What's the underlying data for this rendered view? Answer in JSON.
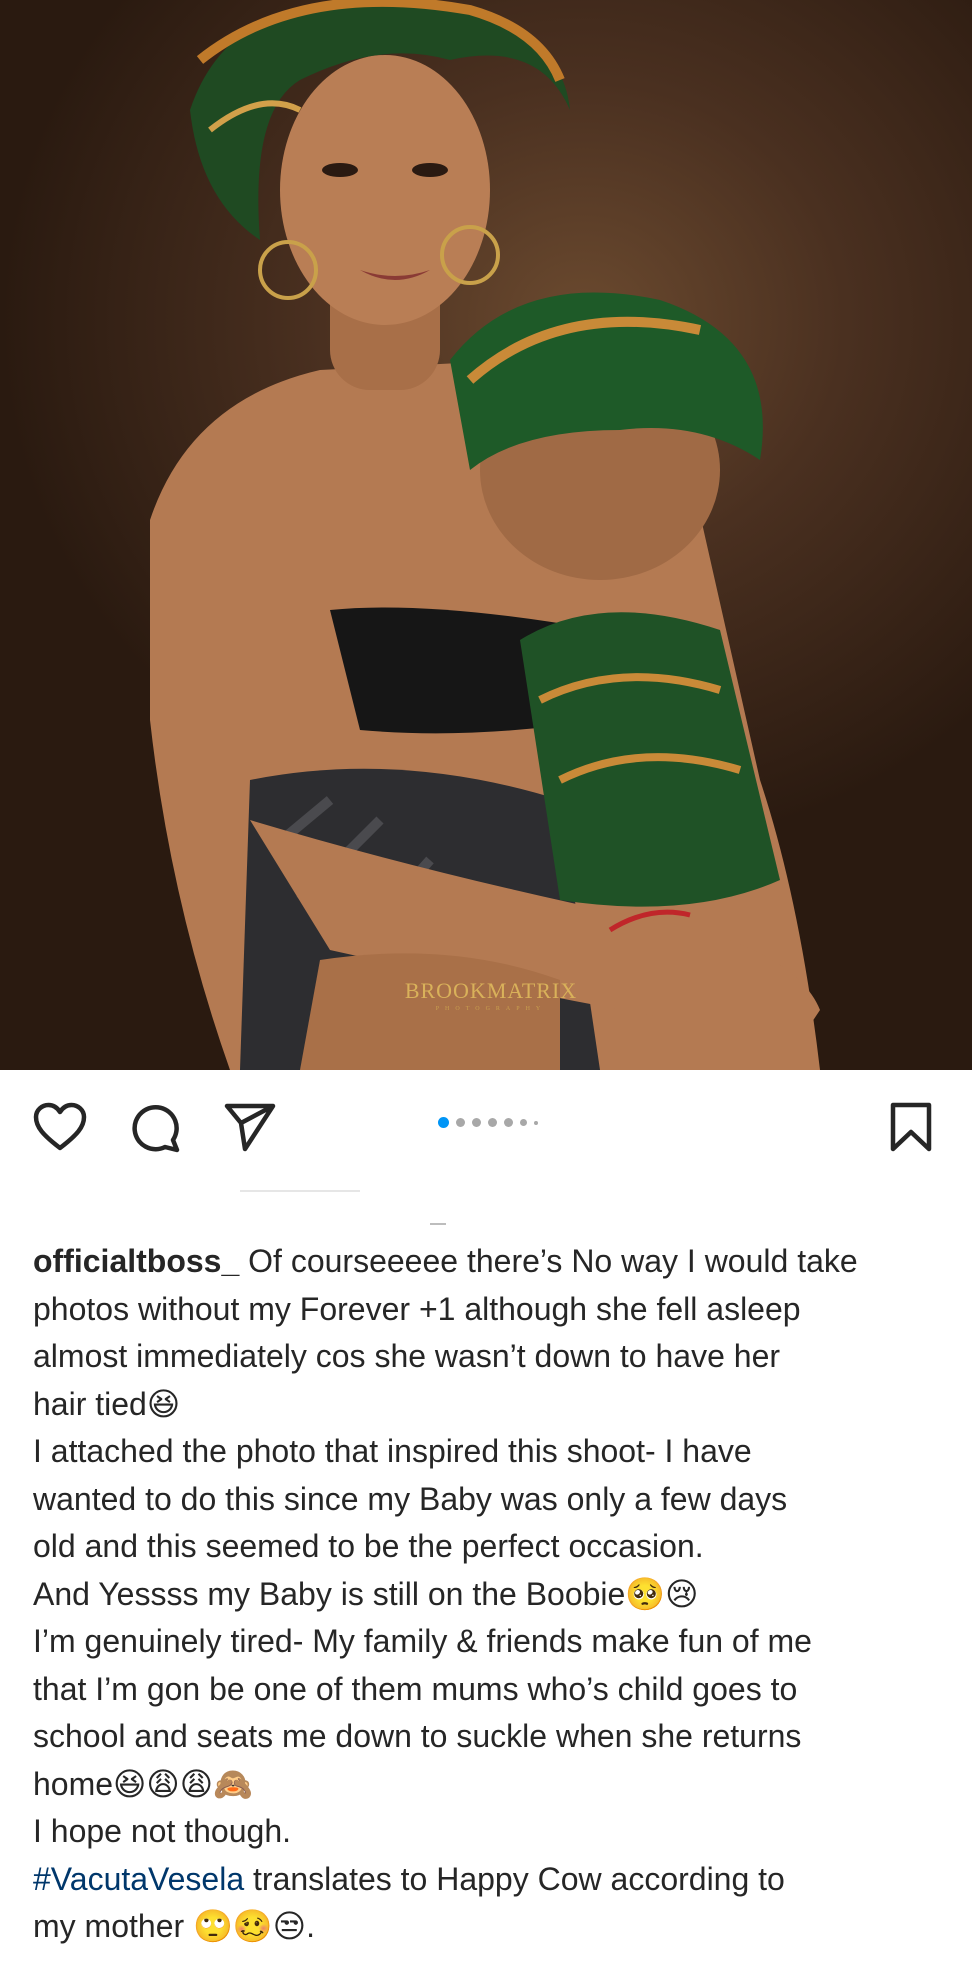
{
  "post": {
    "watermark": "BROOKMATRIX",
    "watermark_sub": "PHOTOGRAPHY",
    "carousel": {
      "count": 7,
      "active_index": 0
    }
  },
  "actions": {
    "like_icon": "heart-icon",
    "comment_icon": "comment-icon",
    "share_icon": "paper-plane-icon",
    "save_icon": "bookmark-icon"
  },
  "caption": {
    "username": "officialtboss_",
    "lines": [
      " Of courseeeee there’s No way I would take",
      "photos without my Forever +1 although she fell asleep",
      "almost immediately cos she wasn’t down to have her",
      "hair tied😆",
      " I attached the photo that inspired this shoot- I have",
      "wanted to do this since my Baby was only a few days",
      "old and this seemed to be the perfect occasion.",
      "And Yessss my Baby is still on the Boobie🥺😢",
      "I’m genuinely tired- My family & friends make fun of me",
      "that I’m gon be one of them mums who’s child goes to",
      "school and seats me down to suckle when she returns",
      "home😆😩😩🙈",
      "I hope not though."
    ],
    "hashtag": "#VacutaVesela",
    "hashtag_rest": " translates to Happy Cow according to",
    "last_line": "my mother 🙄🥴😒."
  },
  "colors": {
    "accent_blue": "#0095f6",
    "hashtag": "#00376b",
    "text": "#262626",
    "watermark_gold": "#d9b15a"
  }
}
